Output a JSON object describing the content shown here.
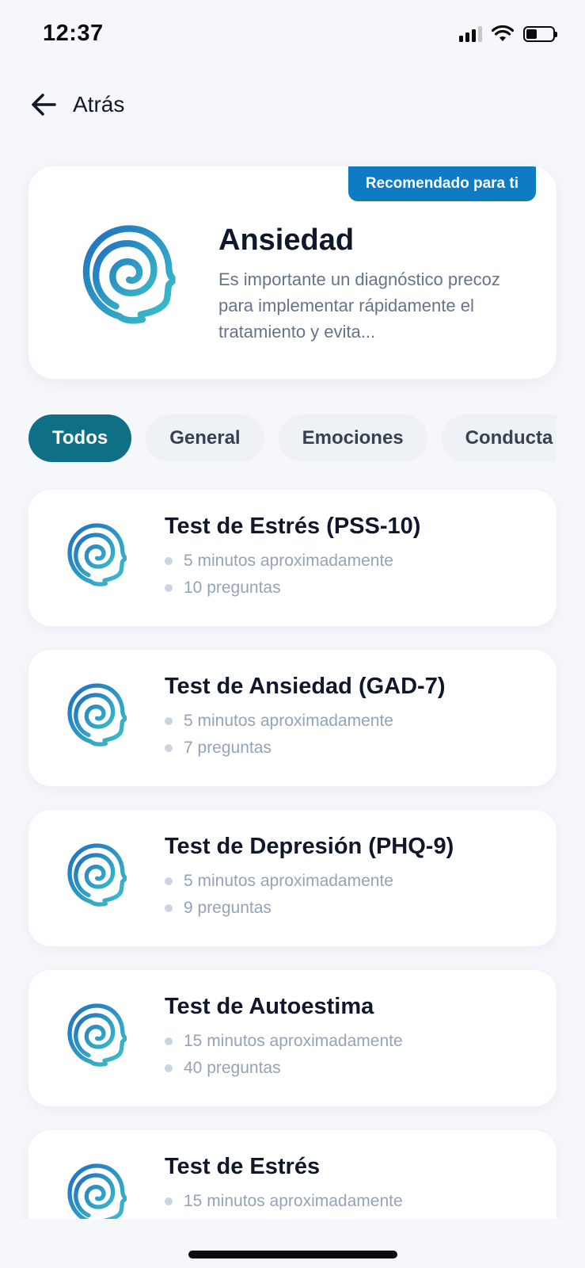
{
  "status_bar": {
    "time": "12:37"
  },
  "nav": {
    "back_label": "Atrás"
  },
  "hero": {
    "badge": "Recomendado para ti",
    "title": "Ansiedad",
    "description": "Es importante un diagnóstico precoz para implementar rápidamente el tratamiento y evita..."
  },
  "filters": [
    {
      "label": "Todos",
      "active": true
    },
    {
      "label": "General",
      "active": false
    },
    {
      "label": "Emociones",
      "active": false
    },
    {
      "label": "Conducta",
      "active": false
    }
  ],
  "tests": [
    {
      "title": "Test de Estrés (PSS-10)",
      "duration": "5 minutos aproximadamente",
      "questions": "10 preguntas"
    },
    {
      "title": "Test de Ansiedad (GAD-7)",
      "duration": "5 minutos aproximadamente",
      "questions": "7 preguntas"
    },
    {
      "title": "Test de Depresión (PHQ-9)",
      "duration": "5 minutos aproximadamente",
      "questions": "9 preguntas"
    },
    {
      "title": "Test de Autoestima",
      "duration": "15 minutos aproximadamente",
      "questions": "40 preguntas"
    },
    {
      "title": "Test de Estrés",
      "duration": "15 minutos aproximadamente",
      "questions": ""
    }
  ],
  "colors": {
    "accent_badge": "#0e7bc3",
    "chip_active": "#0f6f86",
    "icon_gradient_start": "#1f6fbf",
    "icon_gradient_end": "#3cc1c9"
  },
  "icons": {
    "back": "arrow-left-icon",
    "test": "head-mind-icon",
    "signal": "cellular-signal-icon",
    "wifi": "wifi-icon",
    "battery": "battery-icon"
  }
}
